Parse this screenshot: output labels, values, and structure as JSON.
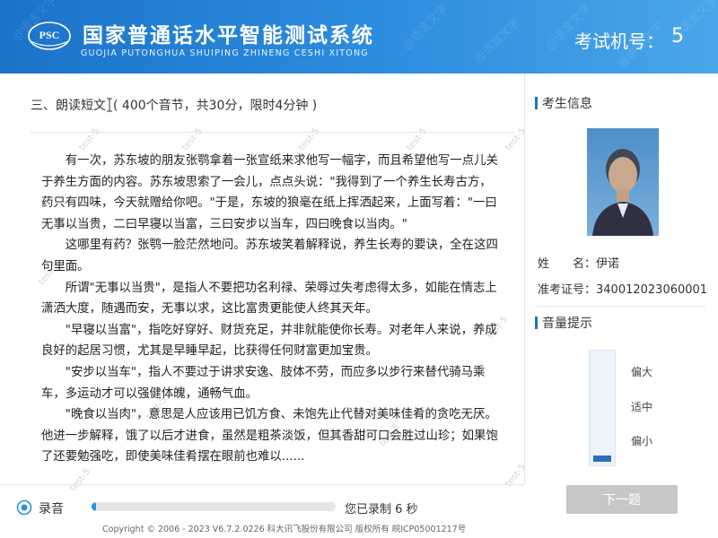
{
  "header": {
    "logo_text": "PSC",
    "title": "国家普通话水平智能测试系统",
    "subtitle": "GUOJIA PUTONGHUA SHUIPING ZHINENG CESHI XITONG",
    "exam_machine_label": "考试机号：",
    "exam_machine_number": "5",
    "watermark": "@语言文字"
  },
  "section": {
    "title_part1": "三、朗读短文",
    "title_part2": "( 400个音节，共30分，限时4分钟 )"
  },
  "watermark_small": "test-5",
  "passage": [
    "有一次，苏东坡的朋友张鹗拿着一张宣纸来求他写一幅字，而且希望他写一点儿关于养生方面的内容。苏东坡思索了一会儿，点点头说：\"我得到了一个养生长寿古方，药只有四味，今天就赠给你吧。\"于是，东坡的狼毫在纸上挥洒起来，上面写着：\"一曰无事以当贵，二曰早寝以当富，三曰安步以当车，四曰晚食以当肉。\"",
    "这哪里有药？张鹗一脸茫然地问。苏东坡笑着解释说，养生长寿的要诀，全在这四句里面。",
    "所谓\"无事以当贵\"，是指人不要把功名利禄、荣辱过失考虑得太多，如能在情志上潇洒大度，随遇而安，无事以求，这比富贵更能使人终其天年。",
    "\"早寝以当富\"，指吃好穿好、财货充足，并非就能使你长寿。对老年人来说，养成良好的起居习惯，尤其是早睡早起，比获得任何财富更加宝贵。",
    "\"安步以当车\"，指人不要过于讲求安逸、肢体不劳，而应多以步行来替代骑马乘车，多运动才可以强健体魄，通畅气血。",
    "\"晚食以当肉\"，意思是人应该用已饥方食、未饱先止代替对美味佳肴的贪吃无厌。他进一步解释，饿了以后才进食，虽然是粗茶淡饭，但其香甜可口会胜过山珍；如果饱了还要勉强吃，即使美味佳肴摆在眼前也难以......"
  ],
  "sidebar": {
    "candidate_info_title": "考生信息",
    "name_label": "姓　　名：",
    "name_value": "伊诺",
    "id_label": "准考证号：",
    "id_value": "340012023060001",
    "volume_title": "音量提示",
    "volume_high": "偏大",
    "volume_mid": "适中",
    "volume_low": "偏小",
    "volume_level_fraction": 0.06,
    "next_button": "下一题"
  },
  "recording": {
    "label": "录音",
    "progress_fraction": 0.02,
    "status": "您已录制 6 秒"
  },
  "footer": {
    "copyright": "Copyright © 2006 - 2023 V6.7.2.0226 科大讯飞股份有限公司 版权所有 皖ICP05001217号"
  },
  "colors": {
    "header_blue": "#1b73c9",
    "accent_blue": "#2d8ee0",
    "volume_blue": "#2d6fbf",
    "button_disabled": "#c7c7c7"
  }
}
